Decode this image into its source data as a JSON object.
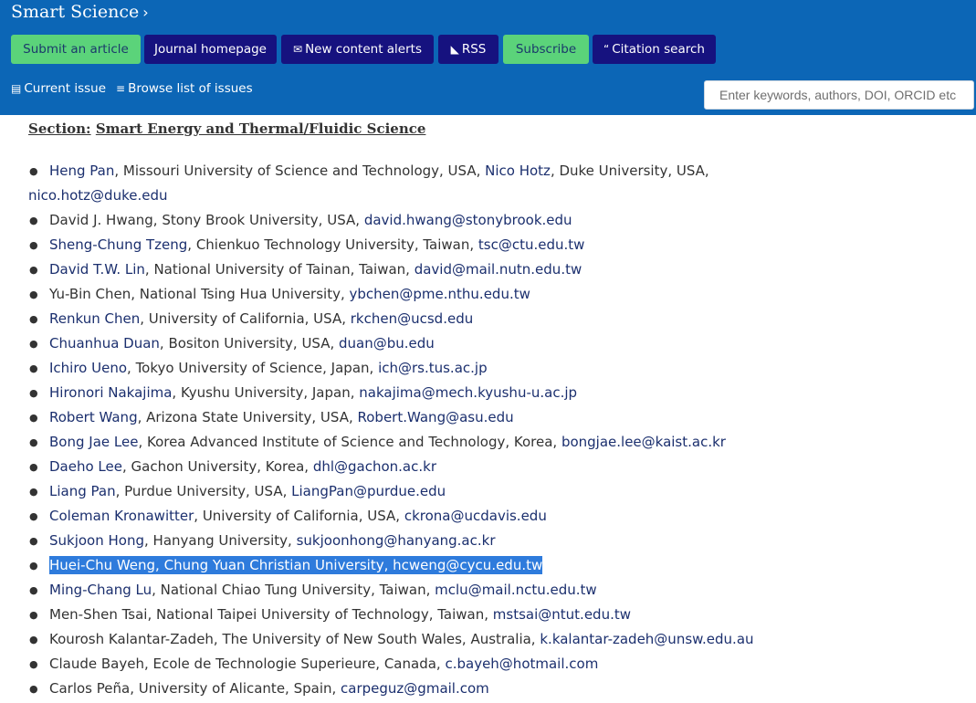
{
  "journal": {
    "title": "Smart Science",
    "chevron": "›"
  },
  "buttons": {
    "submit": "Submit an article",
    "homepage": "Journal homepage",
    "alerts": "New content alerts",
    "rss": "RSS",
    "subscribe": "Subscribe",
    "citation": "Citation search"
  },
  "icons": {
    "envelope": "✉",
    "rss": "◣",
    "quote": "“",
    "book": "▤",
    "list": "≡"
  },
  "nav": {
    "current_issue": "Current issue",
    "browse": "Browse list of issues"
  },
  "search": {
    "placeholder": "Enter keywords, authors, DOI, ORCID etc"
  },
  "section": {
    "label": "Section:",
    "name": "Smart Energy and Thermal/Fluidic Science"
  },
  "colors": {
    "header_bg": "#0c66b6",
    "green_button": "#5bd37a",
    "navy_button": "#16127f",
    "link": "#1b2f6e",
    "highlight": "#2e7bdc"
  },
  "members": [
    {
      "name": "Heng Pan",
      "aff": ", Missouri University of Science and Technology, USA,  ",
      "name2": "Nico Hotz",
      "aff2": ", Duke University, USA,",
      "email": "nico.hotz@duke.edu"
    },
    {
      "name": "David J. Hwang, Stony Brook University, USA,",
      "email": "david.hwang@stonybrook.edu"
    },
    {
      "name": "Sheng-Chung Tzeng",
      "aff": ", Chienkuo Technology University, Taiwan,  ",
      "email": "tsc@ctu.edu.tw"
    },
    {
      "name": "David T.W. Lin",
      "aff": ", National University of Tainan, Taiwan,  ",
      "email": "david@mail.nutn.edu.tw"
    },
    {
      "name": "Yu-Bin Chen, National Tsing Hua University,",
      "email": "ybchen@pme.nthu.edu.tw"
    },
    {
      "name": "Renkun Chen",
      "aff": ", University of California, USA,  ",
      "email": "rkchen@ucsd.edu"
    },
    {
      "name": "Chuanhua Duan",
      "aff": ", Bositon University, USA,  ",
      "email": "duan@bu.edu"
    },
    {
      "name": "Ichiro Ueno",
      "aff": ", Tokyo University of Science, Japan,  ",
      "email": "ich@rs.tus.ac.jp"
    },
    {
      "name": "Hironori Nakajima",
      "aff": ", Kyushu University, Japan,  ",
      "email": "nakajima@mech.kyushu-u.ac.jp"
    },
    {
      "name": "Robert Wang",
      "aff": ", Arizona State University, USA,  ",
      "email": "Robert.Wang@asu.edu"
    },
    {
      "name": "Bong Jae Lee",
      "aff": ", Korea Advanced Institute of Science and Technology, Korea,  ",
      "email": "bongjae.lee@kaist.ac.kr"
    },
    {
      "name": "Daeho Lee",
      "aff": ", Gachon University, Korea,  ",
      "email": "dhl@gachon.ac.kr"
    },
    {
      "name": "Liang Pan",
      "aff": ", Purdue University, USA,  ",
      "email": "LiangPan@purdue.edu"
    },
    {
      "name": "Coleman Kronawitter",
      "aff": ", University of California, USA,  ",
      "email": "ckrona@ucdavis.edu"
    },
    {
      "name": "Sukjoon Hong",
      "aff": ", Hanyang University,",
      "email": "sukjoonhong@hanyang.ac.kr"
    },
    {
      "name": "Huei-Chu Weng, Chung Yuan Christian University,",
      "email": "hcweng@cycu.edu.tw"
    },
    {
      "name": "Ming-Chang Lu",
      "aff": ", National Chiao Tung University, Taiwan,  ",
      "email": "mclu@mail.nctu.edu.tw"
    },
    {
      "name": "Men-Shen Tsai, National Taipei University of Technology, Taiwan,",
      "email": "mstsai@ntut.edu.tw"
    },
    {
      "name": "Kourosh Kalantar-Zadeh, The University of New South Wales, Australia,",
      "email": "k.kalantar-zadeh@unsw.edu.au"
    },
    {
      "name": "Claude Bayeh, Ecole de Technologie Superieure, Canada,",
      "email": "c.bayeh@hotmail.com"
    },
    {
      "name": "Carlos Peña, University of Alicante, Spain,",
      "email": "carpeguz@gmail.com"
    }
  ]
}
